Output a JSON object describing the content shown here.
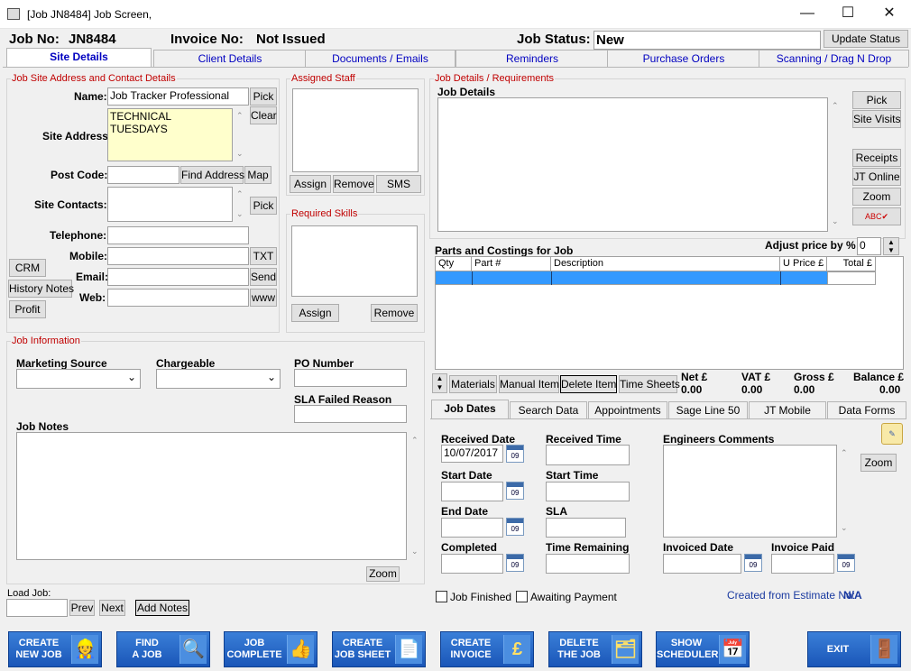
{
  "window": {
    "title": "[Job JN8484] Job Screen,",
    "minimize": "—",
    "maximize": "☐",
    "close": "✕"
  },
  "header": {
    "job_no_label": "Job No:",
    "job_no": "JN8484",
    "invoice_label": "Invoice No:",
    "invoice_value": "Not Issued",
    "status_label": "Job Status:",
    "status_value": "New",
    "update_status": "Update Status"
  },
  "tabs": [
    "Site Details",
    "Client Details",
    "Documents / Emails",
    "Reminders",
    "Purchase Orders",
    "Scanning / Drag N Drop"
  ],
  "site": {
    "group_title": "Job Site Address and Contact Details",
    "name_label": "Name:",
    "name_value": "Job Tracker Professional",
    "pick": "Pick",
    "clear": "Clear",
    "address_label": "Site Address",
    "address_value": "TECHNICAL TUESDAYS",
    "postcode_label": "Post Code:",
    "find_address": "Find Address",
    "map": "Map",
    "contacts_label": "Site Contacts:",
    "contacts_pick": "Pick",
    "telephone_label": "Telephone:",
    "mobile_label": "Mobile:",
    "txt": "TXT",
    "email_label": "Email:",
    "send": "Send",
    "web_label": "Web:",
    "www": "www",
    "crm": "CRM",
    "history_notes": "History Notes",
    "profit": "Profit"
  },
  "staff": {
    "group_title": "Assigned Staff",
    "assign": "Assign",
    "remove": "Remove",
    "sms": "SMS"
  },
  "skills": {
    "group_title": "Required Skills",
    "assign": "Assign",
    "remove": "Remove"
  },
  "jobinfo": {
    "group_title": "Job Information",
    "marketing_source": "Marketing Source",
    "chargeable": "Chargeable",
    "po_number": "PO Number",
    "sla_failed": "SLA Failed Reason",
    "job_notes": "Job Notes",
    "zoom": "Zoom",
    "load_job": "Load Job:",
    "prev": "Prev",
    "next": "Next",
    "add_notes": "Add Notes"
  },
  "jobdetails": {
    "group_title": "Job Details / Requirements",
    "job_details_label": "Job Details",
    "pick": "Pick",
    "site_visits": "Site Visits",
    "receipts": "Receipts",
    "jt_online": "JT Online",
    "zoom": "Zoom",
    "spell": "ABC✔"
  },
  "parts": {
    "title": "Parts and Costings for Job",
    "adjust_label": "Adjust price by %",
    "adjust_value": "0",
    "columns": [
      "Qty",
      "Part #",
      "Description",
      "U Price £",
      "Total £"
    ],
    "materials": "Materials",
    "manual_item": "Manual Item",
    "delete_item": "Delete Item",
    "time_sheets": "Time Sheets",
    "net_label": "Net £",
    "net": "0.00",
    "vat_label": "VAT £",
    "vat": "0.00",
    "gross_label": "Gross £",
    "gross": "0.00",
    "balance_label": "Balance £",
    "balance": "0.00"
  },
  "subtabs": [
    "Job Dates",
    "Search Data",
    "Appointments",
    "Sage Line 50",
    "JT Mobile",
    "Data Forms"
  ],
  "dates": {
    "received_date": "Received Date",
    "received_date_value": "10/07/2017",
    "received_time": "Received Time",
    "start_date": "Start Date",
    "start_time": "Start Time",
    "end_date": "End Date",
    "sla": "SLA",
    "completed": "Completed",
    "time_remaining": "Time Remaining",
    "engineers_comments": "Engineers Comments",
    "zoom": "Zoom",
    "invoiced_date": "Invoiced Date",
    "invoice_paid": "Invoice Paid",
    "job_finished": "Job Finished",
    "awaiting_payment": "Awaiting Payment",
    "created_from": "Created from Estimate  No:",
    "created_from_value": "N/A",
    "cal_day": "09"
  },
  "bottom": [
    {
      "l1": "CREATE",
      "l2": "NEW JOB",
      "icon": "👷"
    },
    {
      "l1": "FIND",
      "l2": "A JOB",
      "icon": "🔍"
    },
    {
      "l1": "JOB",
      "l2": "COMPLETE",
      "icon": "👍"
    },
    {
      "l1": "CREATE",
      "l2": "JOB SHEET",
      "icon": "📄"
    },
    {
      "l1": "CREATE",
      "l2": "INVOICE",
      "icon": "£"
    },
    {
      "l1": "DELETE",
      "l2": "THE JOB",
      "icon": "🗂"
    },
    {
      "l1": "SHOW",
      "l2": "SCHEDULER",
      "icon": "📅"
    },
    {
      "l1": "EXIT",
      "l2": "",
      "icon": "🚪"
    }
  ]
}
